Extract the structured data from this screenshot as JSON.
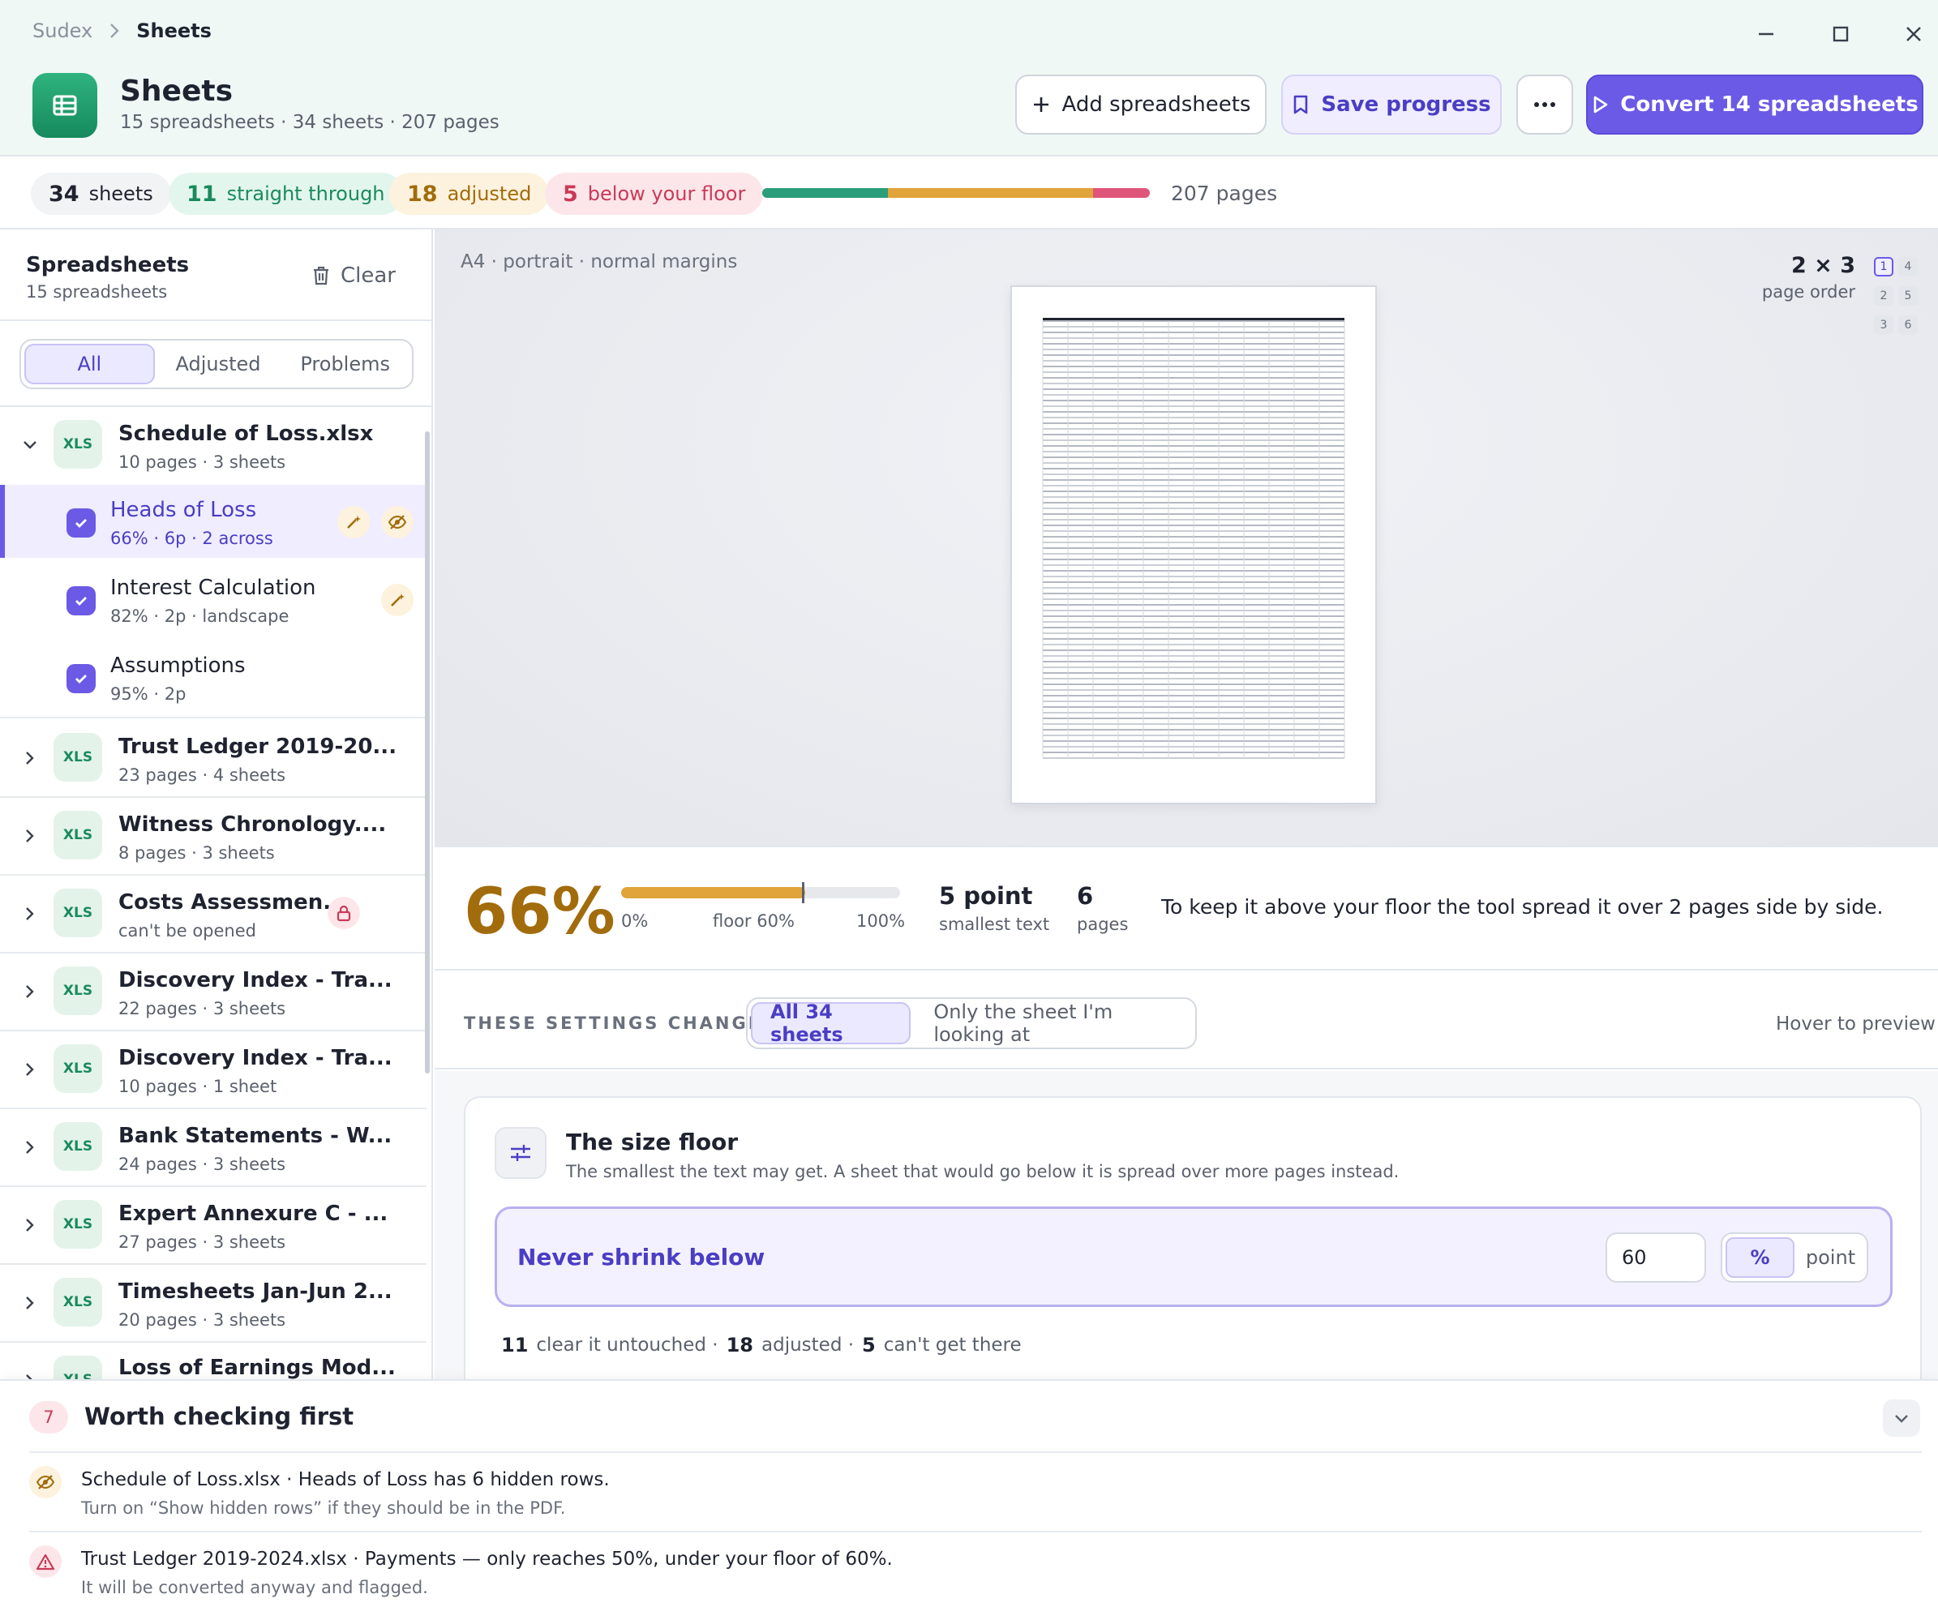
{
  "breadcrumb": {
    "root": "Sudex",
    "current": "Sheets"
  },
  "window": {
    "minimize_icon": "minimize-icon",
    "maximize_icon": "maximize-icon",
    "close_icon": "close-icon"
  },
  "header": {
    "app_icon": "spreadsheet-icon",
    "title": "Sheets",
    "subtitle": "15 spreadsheets · 34 sheets · 207 pages",
    "add_label": "Add spreadsheets",
    "save_label": "Save progress",
    "more_icon": "more-icon",
    "convert_label": "Convert 14 spreadsheets"
  },
  "stats": {
    "sheets": {
      "count": "34",
      "label": "sheets"
    },
    "straight": {
      "count": "11",
      "label": "straight through"
    },
    "adjusted": {
      "count": "18",
      "label": "adjusted"
    },
    "below": {
      "count": "5",
      "label": "below your floor"
    },
    "bar": [
      {
        "value": 11,
        "color": "#2a9d7a"
      },
      {
        "value": 18,
        "color": "#e0a43a"
      },
      {
        "value": 5,
        "color": "#e0557a"
      }
    ],
    "pages_label": "207 pages"
  },
  "sidebar": {
    "title": "Spreadsheets",
    "subtitle": "15 spreadsheets",
    "clear_label": "Clear",
    "filters": [
      "All",
      "Adjusted",
      "Problems"
    ],
    "active_filter": "All",
    "expanded_file": {
      "badge": "XLS",
      "name": "Schedule of Loss.xlsx",
      "meta": "10 pages · 3 sheets",
      "sheets": [
        {
          "name": "Heads of Loss",
          "meta": "66% · 6p · 2 across",
          "selected": true,
          "badges": [
            "wand-icon",
            "eye-off-icon"
          ]
        },
        {
          "name": "Interest Calculation",
          "meta": "82% · 2p · landscape",
          "selected": false,
          "badges": [
            "wand-icon"
          ]
        },
        {
          "name": "Assumptions",
          "meta": "95% · 2p",
          "selected": false,
          "badges": []
        }
      ]
    },
    "files": [
      {
        "badge": "XLS",
        "name": "Trust Ledger 2019-20...",
        "meta": "23 pages · 4 sheets"
      },
      {
        "badge": "XLS",
        "name": "Witness Chronology....",
        "meta": "8 pages · 3 sheets"
      },
      {
        "badge": "XLS",
        "name": "Costs Assessmen...",
        "meta": "can't be opened",
        "locked": true
      },
      {
        "badge": "XLS",
        "name": "Discovery Index - Tra...",
        "meta": "22 pages · 3 sheets"
      },
      {
        "badge": "XLS",
        "name": "Discovery Index - Tra...",
        "meta": "10 pages · 1 sheet"
      },
      {
        "badge": "XLS",
        "name": "Bank Statements - W...",
        "meta": "24 pages · 3 sheets"
      },
      {
        "badge": "XLS",
        "name": "Expert Annexure C - ...",
        "meta": "27 pages · 3 sheets"
      },
      {
        "badge": "XLS",
        "name": "Timesheets Jan-Jun 2...",
        "meta": "20 pages · 3 sheets"
      },
      {
        "badge": "XLS",
        "name": "Loss of Earnings Mod...",
        "meta": ""
      }
    ]
  },
  "preview": {
    "info": "A4 · portrait · normal margins",
    "grid_label": "2 × 3",
    "order_label": "page order",
    "order_cells": [
      "1",
      "4",
      "2",
      "5",
      "3",
      "6"
    ]
  },
  "metrics": {
    "scale": "66%",
    "scale_value": 66,
    "floor_value": 60,
    "min_label": "0%",
    "floor_label": "floor 60%",
    "max_label": "100%",
    "smallest_text_value": "5 point",
    "smallest_text_label": "smallest text",
    "pages_value": "6",
    "pages_label": "pages",
    "message": "To keep it above your floor the tool spread it over 2 pages side by side."
  },
  "scope": {
    "label": "THESE SETTINGS CHANGE",
    "options": [
      "All 34 sheets",
      "Only the sheet I'm looking at"
    ],
    "active": "All 34 sheets",
    "hint": "Hover to preview"
  },
  "floor": {
    "icon": "sliders-icon",
    "title": "The size floor",
    "description": "The smallest the text may get. A sheet that would go below it is spread over more pages instead.",
    "field_label": "Never shrink below",
    "value": "60",
    "units": [
      "%",
      "point"
    ],
    "active_unit": "%",
    "counts": [
      {
        "n": "11",
        "label": "clear it untouched ·"
      },
      {
        "n": "18",
        "label": "adjusted ·"
      },
      {
        "n": "5",
        "label": "can't get there"
      }
    ]
  },
  "checks": {
    "count": "7",
    "title": "Worth checking first",
    "items": [
      {
        "icon": "eye-off-icon",
        "title": "Schedule of Loss.xlsx · Heads of Loss has 6 hidden rows.",
        "detail": "Turn on “Show hidden rows” if they should be in the PDF."
      },
      {
        "icon": "warning-icon",
        "title": "Trust Ledger 2019-2024.xlsx · Payments — only reaches 50%, under your floor of 60%.",
        "detail": "It will be converted anyway and flagged."
      }
    ]
  }
}
